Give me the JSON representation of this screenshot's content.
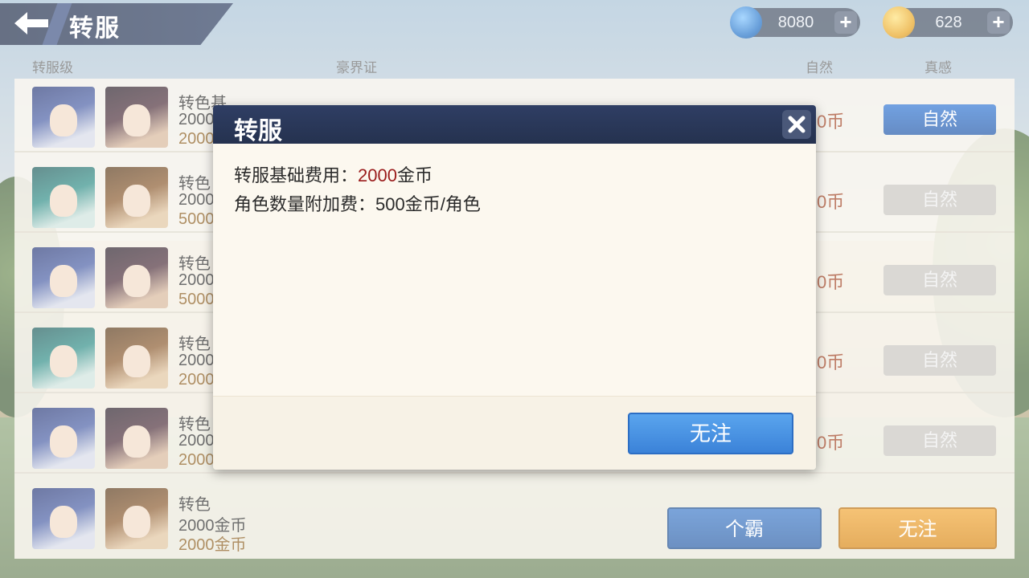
{
  "header": {
    "title": "转服",
    "back_icon": "arrow-left-icon"
  },
  "currencies": [
    {
      "icon": "gem-icon",
      "value": "8080",
      "color": "#2f7fd6"
    },
    {
      "icon": "gold-coin-icon",
      "value": "628",
      "color": "#e7a21c"
    }
  ],
  "list_header": {
    "col1": "转服级",
    "col2": "豪界证",
    "col3": "自然",
    "col4": "真感"
  },
  "rows": [
    {
      "name": "转色基",
      "line2": "2000",
      "line3": "2000",
      "cost": "0币",
      "button": "自然",
      "state": "on"
    },
    {
      "name": "转色",
      "line2": "2000",
      "line3": "5000",
      "cost": "0币",
      "button": "自然",
      "state": "off"
    },
    {
      "name": "转色",
      "line2": "2000",
      "line3": "5000",
      "cost": "0币",
      "button": "自然",
      "state": "off"
    },
    {
      "name": "转色",
      "line2": "2000",
      "line3": "2000",
      "cost": "0币",
      "button": "自然",
      "state": "off"
    },
    {
      "name": "转色",
      "line2": "2000",
      "line3": "2000",
      "cost": "0币",
      "button": "自然",
      "state": "off"
    },
    {
      "name": "转色",
      "line2": "2000金币",
      "line3": "2000金币",
      "cost": "",
      "button": "",
      "state": "none"
    }
  ],
  "bottom_buttons": {
    "cancel": "个霸",
    "confirm": "无注"
  },
  "modal": {
    "title": "转服",
    "close_icon": "close-icon",
    "line1_label": "转服基础费用：",
    "line1_value": "2000",
    "line1_unit": "金币",
    "line2": "角色数量附加费：500金币/角色",
    "ok_label": "无注"
  },
  "colors": {
    "accent_blue": "#3b82d8",
    "accent_orange": "#e89620",
    "header_navy": "#25324f",
    "highlight_red": "#9a1b1b"
  }
}
